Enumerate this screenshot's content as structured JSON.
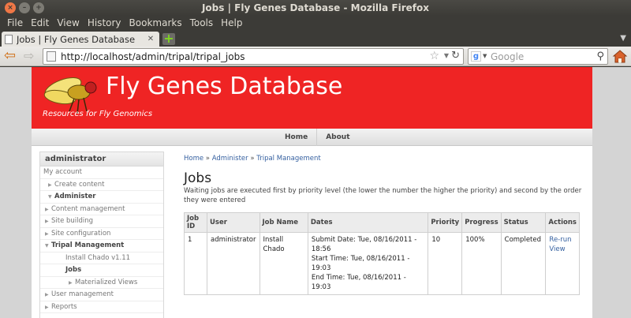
{
  "window": {
    "title": "Jobs | Fly Genes Database - Mozilla Firefox"
  },
  "menubar": {
    "items": [
      "File",
      "Edit",
      "View",
      "History",
      "Bookmarks",
      "Tools",
      "Help"
    ]
  },
  "tabs": [
    {
      "label": "Jobs | Fly Genes Database"
    }
  ],
  "navbar": {
    "url": "http://localhost/admin/tripal/tripal_jobs",
    "search_placeholder": "Google"
  },
  "site": {
    "name": "Fly Genes Database",
    "slogan": "Resources for Fly Genomics",
    "primary_links": [
      "Home",
      "About"
    ]
  },
  "sidebar": {
    "title": "administrator",
    "items": [
      {
        "label": "My account",
        "level": 0,
        "arrow": "",
        "bold": false
      },
      {
        "label": "Create content",
        "level": 1,
        "arrow": "▶",
        "bold": false
      },
      {
        "label": "Administer",
        "level": 1,
        "arrow": "▼",
        "bold": true
      },
      {
        "label": "Content management",
        "level": 2,
        "arrow": "▶",
        "bold": false
      },
      {
        "label": "Site building",
        "level": 2,
        "arrow": "▶",
        "bold": false
      },
      {
        "label": "Site configuration",
        "level": 2,
        "arrow": "▶",
        "bold": false
      },
      {
        "label": "Tripal Management",
        "level": 2,
        "arrow": "▼",
        "bold": true
      },
      {
        "label": "Install Chado v1.11",
        "level": 3,
        "arrow": "",
        "bold": false
      },
      {
        "label": "Jobs",
        "level": 3,
        "arrow": "",
        "bold": true
      },
      {
        "label": "Materialized Views",
        "level": 4,
        "arrow": "▶",
        "bold": false
      },
      {
        "label": "User management",
        "level": 2,
        "arrow": "▶",
        "bold": false
      },
      {
        "label": "Reports",
        "level": 2,
        "arrow": "▶",
        "bold": false
      }
    ]
  },
  "breadcrumb": [
    "Home",
    "Administer",
    "Tripal Management"
  ],
  "main": {
    "title": "Jobs",
    "help": "Waiting jobs are executed first by priority level (the lower the number the higher the priority) and second by the order they were entered"
  },
  "jobs_table": {
    "headers": [
      "Job ID",
      "User",
      "Job Name",
      "Dates",
      "Priority",
      "Progress",
      "Status",
      "Actions"
    ],
    "rows": [
      {
        "id": "1",
        "user": "administrator",
        "name": "Install Chado",
        "dates": [
          "Submit Date: Tue, 08/16/2011 - 18:56",
          "Start Time: Tue, 08/16/2011 - 19:03",
          "End Time: Tue, 08/16/2011 - 19:03"
        ],
        "priority": "10",
        "progress": "100%",
        "status": "Completed",
        "actions": [
          "Re-run",
          "View"
        ]
      }
    ]
  },
  "colors": {
    "header_red": "#ef2424",
    "link_blue": "#3560a0",
    "chrome_dark": "#3c3b37"
  }
}
